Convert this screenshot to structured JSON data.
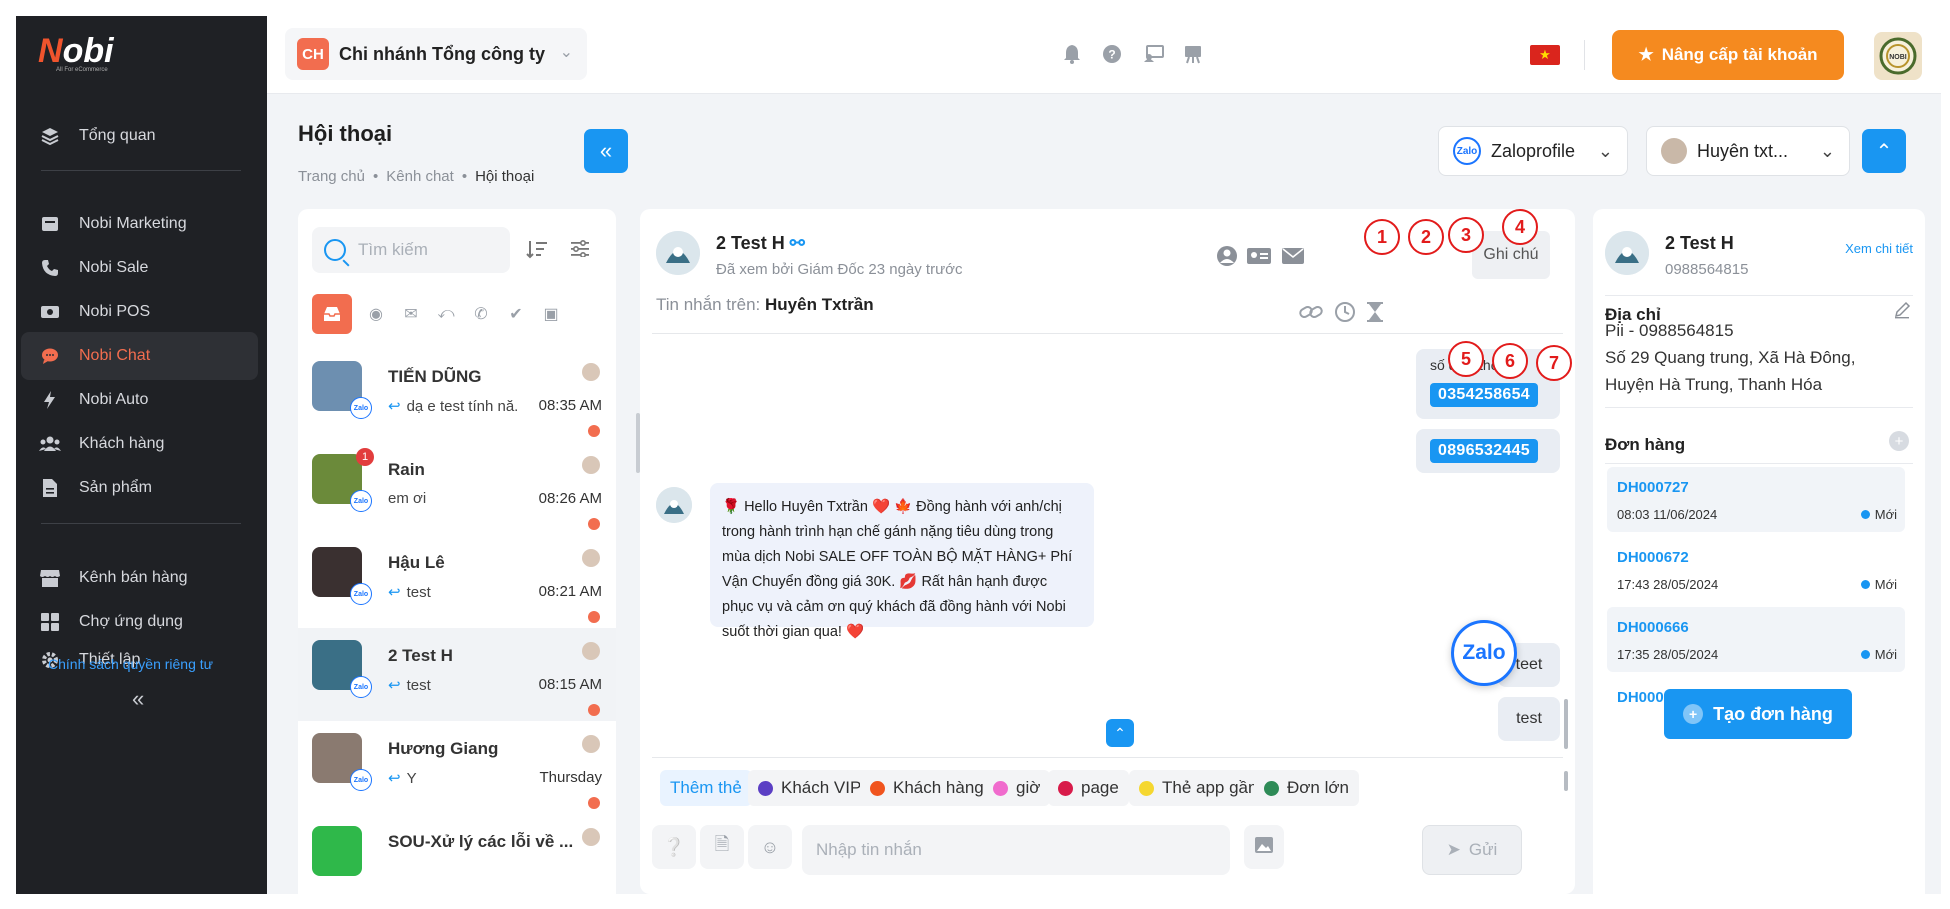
{
  "logo": {
    "text": "Nobi",
    "tagline": "All For eCommerce"
  },
  "sidebar": {
    "items": [
      {
        "label": "Tổng quan",
        "icon": "layers-icon"
      },
      {
        "label": "Nobi Marketing",
        "icon": "marketing-icon"
      },
      {
        "label": "Nobi Sale",
        "icon": "phone-icon"
      },
      {
        "label": "Nobi POS",
        "icon": "pos-icon"
      },
      {
        "label": "Nobi Chat",
        "icon": "chat-icon"
      },
      {
        "label": "Nobi Auto",
        "icon": "auto-icon"
      },
      {
        "label": "Khách hàng",
        "icon": "customers-icon"
      },
      {
        "label": "Sản phẩm",
        "icon": "products-icon"
      },
      {
        "label": "Kênh bán hàng",
        "icon": "store-icon"
      },
      {
        "label": "Chợ ứng dụng",
        "icon": "apps-icon"
      },
      {
        "label": "Thiết lập",
        "icon": "gear-icon"
      }
    ],
    "active": "Nobi Chat",
    "privacy": "Chính sách quyền riêng tư",
    "collapse": "«"
  },
  "header": {
    "branch_badge": "CH",
    "branch_name": "Chi nhánh Tổng công ty",
    "upgrade_label": "Nâng cấp tài khoản",
    "account_logo": "NOBI"
  },
  "page": {
    "title": "Hội thoại",
    "breadcrumb": [
      "Trang chủ",
      "Kênh chat",
      "Hội thoại"
    ],
    "channel_select": "Zaloprofile",
    "channel_logo": "Zalo",
    "account_select": "Huyên txt..."
  },
  "list": {
    "search_placeholder": "Tìm kiếm",
    "zalo_badge": "Zalo",
    "conversations": [
      {
        "name": "TIẾN DŨNG",
        "message": "dạ e test tính nă...",
        "time": "08:35 AM",
        "reply": true,
        "unread": ""
      },
      {
        "name": "Rain",
        "message": "em ơi",
        "time": "08:26 AM",
        "reply": false,
        "unread": "1"
      },
      {
        "name": "Hậu Lê",
        "message": "test",
        "time": "08:21 AM",
        "reply": true,
        "unread": ""
      },
      {
        "name": "2 Test H",
        "message": "test",
        "time": "08:15 AM",
        "reply": true,
        "unread": ""
      },
      {
        "name": "Hương Giang",
        "message": "Y",
        "time": "Thursday",
        "reply": true,
        "unread": ""
      },
      {
        "name": "SOU-Xử lý các lỗi về ...",
        "message": "",
        "time": "",
        "reply": false,
        "unread": ""
      }
    ]
  },
  "chat": {
    "name": "2 Test H",
    "seen": "Đã xem bởi Giám Đốc 23 ngày trước",
    "on_label": "Tin nhắn trên:",
    "on_value": "Huyên Txtrần",
    "note_label": "Ghi chú",
    "callouts": [
      "1",
      "2",
      "3",
      "4",
      "5",
      "6",
      "7"
    ],
    "partial_text": "số điện thoại",
    "phones": [
      "0354258654",
      "0896532445"
    ],
    "bot_message": "🌹 Hello Huyên Txtrần ❤️ 🍁 Đồng hành với anh/chị trong hành trình hạn chế gánh nặng tiêu dùng trong mùa dịch Nobi SALE OFF TOÀN BỘ MẶT HÀNG+ Phí Vận Chuyển đồng giá 30K. 💋 Rất hân hạnh được phục vụ và cảm ơn quý khách đã đồng hành với Nobi suốt thời gian qua! ❤️",
    "replies": [
      "teet",
      "test"
    ],
    "add_tag": "Thêm thẻ",
    "tags": [
      {
        "label": "Khách VIP",
        "color": "#5b3fc4"
      },
      {
        "label": "Khách hàng",
        "color": "#f0541e"
      },
      {
        "label": "giờ",
        "color": "#f06bcd"
      },
      {
        "label": "page",
        "color": "#d81b4a"
      },
      {
        "label": "Thẻ app gần",
        "color": "#f5d730"
      },
      {
        "label": "Đơn lớn",
        "color": "#2e8b57"
      }
    ],
    "input_placeholder": "Nhập tin nhắn",
    "send_label": "Gửi"
  },
  "customer": {
    "name": "2 Test H",
    "phone": "0988564815",
    "detail_link": "Xem chi tiết",
    "address_title": "Địa chỉ",
    "address_line1": "Pii - 0988564815",
    "address_line2": "Số 29 Quang trung, Xã Hà Đông,",
    "address_line3": "Huyện Hà Trung, Thanh Hóa",
    "orders_title": "Đơn hàng",
    "orders": [
      {
        "code": "DH000727",
        "date": "08:03 11/06/2024",
        "status": "Mới"
      },
      {
        "code": "DH000672",
        "date": "17:43 28/05/2024",
        "status": "Mới"
      },
      {
        "code": "DH000666",
        "date": "17:35 28/05/2024",
        "status": "Mới"
      },
      {
        "code": "DH000664",
        "date": "",
        "status": ""
      }
    ],
    "create_label": "Tạo đơn hàng",
    "zalo_fab": "Zalo"
  },
  "colors": {
    "accent": "#1996f2",
    "brand": "#f26d4f",
    "sidebar_bg": "#1f2125",
    "upgrade": "#f58a1f",
    "callout": "#e21b1b"
  }
}
